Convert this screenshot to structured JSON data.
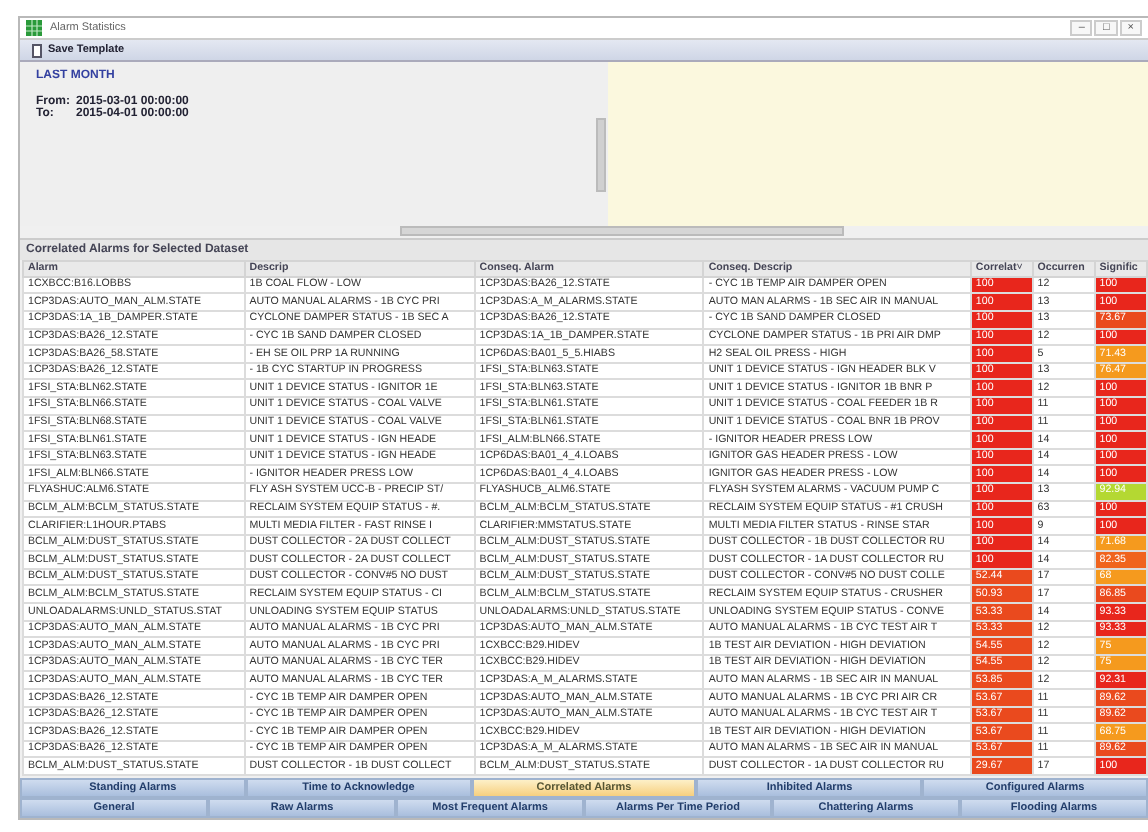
{
  "window": {
    "title": "Alarm Statistics",
    "controls": [
      "–",
      "□",
      "×"
    ]
  },
  "toolbar": {
    "save_button": "Save Template"
  },
  "period": {
    "name": "LAST MONTH",
    "from_label": "From:",
    "from": "2015-03-01 00:00:00",
    "to_label": "To:",
    "to": "2015-04-01 00:00:00"
  },
  "section_title": "Correlated Alarms for Selected Dataset",
  "table": {
    "columns": [
      {
        "label": "Alarm"
      },
      {
        "label": "Descrip"
      },
      {
        "label": "Conseq. Alarm"
      },
      {
        "label": "Conseq. Descrip"
      },
      {
        "label": "Correlat",
        "sort": "˅"
      },
      {
        "label": "Occurren"
      },
      {
        "label": "Signific"
      }
    ],
    "rows": [
      {
        "alarm": "1CXBCC:B16.LOBBS",
        "descrip": "1B COAL FLOW - LOW",
        "conseq_alarm": "1CP3DAS:BA26_12.STATE",
        "conseq_descrip": "- CYC 1B TEMP AIR DAMPER OPEN",
        "correlation": {
          "text": "100",
          "color": "#e8261c"
        },
        "occurrences": "12",
        "significance": {
          "text": "100",
          "color": "#e8261c"
        }
      },
      {
        "alarm": "1CP3DAS:AUTO_MAN_ALM.STATE",
        "descrip": "AUTO MANUAL ALARMS - 1B CYC PRI",
        "conseq_alarm": "1CP3DAS:A_M_ALARMS.STATE",
        "conseq_descrip": "AUTO MAN ALARMS - 1B SEC AIR IN MANUAL",
        "correlation": {
          "text": "100",
          "color": "#e8261c"
        },
        "occurrences": "13",
        "significance": {
          "text": "100",
          "color": "#e8261c"
        }
      },
      {
        "alarm": "1CP3DAS:1A_1B_DAMPER.STATE",
        "descrip": "CYCLONE DAMPER STATUS - 1B SEC A",
        "conseq_alarm": "1CP3DAS:BA26_12.STATE",
        "conseq_descrip": "- CYC 1B SAND DAMPER CLOSED",
        "correlation": {
          "text": "100",
          "color": "#e8261c"
        },
        "occurrences": "13",
        "significance": {
          "text": "73.67",
          "color": "#ea4a1e"
        }
      },
      {
        "alarm": "1CP3DAS:BA26_12.STATE",
        "descrip": "- CYC 1B SAND DAMPER CLOSED",
        "conseq_alarm": "1CP3DAS:1A_1B_DAMPER.STATE",
        "conseq_descrip": "CYCLONE DAMPER STATUS - 1B PRI AIR DMP",
        "correlation": {
          "text": "100",
          "color": "#e8261c"
        },
        "occurrences": "12",
        "significance": {
          "text": "100",
          "color": "#e8261c"
        }
      },
      {
        "alarm": "1CP3DAS:BA26_58.STATE",
        "descrip": "- EH SE OIL PRP 1A RUNNING",
        "conseq_alarm": "1CP6DAS:BA01_5_5.HIABS",
        "conseq_descrip": "H2 SEAL OIL PRESS - HIGH",
        "correlation": {
          "text": "100",
          "color": "#e8261c"
        },
        "occurrences": "5",
        "significance": {
          "text": "71.43",
          "color": "#f59a1e"
        }
      },
      {
        "alarm": "1CP3DAS:BA26_12.STATE",
        "descrip": "- 1B CYC STARTUP IN PROGRESS",
        "conseq_alarm": "1FSI_STA:BLN63.STATE",
        "conseq_descrip": "UNIT 1 DEVICE STATUS - IGN HEADER BLK V",
        "correlation": {
          "text": "100",
          "color": "#e8261c"
        },
        "occurrences": "13",
        "significance": {
          "text": "76.47",
          "color": "#f59a1e"
        }
      },
      {
        "alarm": "1FSI_STA:BLN62.STATE",
        "descrip": "UNIT 1 DEVICE STATUS - IGNITOR 1E",
        "conseq_alarm": "1FSI_STA:BLN63.STATE",
        "conseq_descrip": "UNIT 1 DEVICE STATUS - IGNITOR 1B BNR P",
        "correlation": {
          "text": "100",
          "color": "#e8261c"
        },
        "occurrences": "12",
        "significance": {
          "text": "100",
          "color": "#e8261c"
        }
      },
      {
        "alarm": "1FSI_STA:BLN66.STATE",
        "descrip": "UNIT 1 DEVICE STATUS - COAL VALVE",
        "conseq_alarm": "1FSI_STA:BLN61.STATE",
        "conseq_descrip": "UNIT 1 DEVICE STATUS - COAL FEEDER 1B R",
        "correlation": {
          "text": "100",
          "color": "#e8261c"
        },
        "occurrences": "11",
        "significance": {
          "text": "100",
          "color": "#e8261c"
        }
      },
      {
        "alarm": "1FSI_STA:BLN68.STATE",
        "descrip": "UNIT 1 DEVICE STATUS - COAL VALVE",
        "conseq_alarm": "1FSI_STA:BLN61.STATE",
        "conseq_descrip": "UNIT 1 DEVICE STATUS - COAL BNR 1B PROV",
        "correlation": {
          "text": "100",
          "color": "#e8261c"
        },
        "occurrences": "11",
        "significance": {
          "text": "100",
          "color": "#e8261c"
        }
      },
      {
        "alarm": "1FSI_STA:BLN61.STATE",
        "descrip": "UNIT 1 DEVICE STATUS - IGN HEADE",
        "conseq_alarm": "1FSI_ALM:BLN66.STATE",
        "conseq_descrip": "- IGNITOR HEADER PRESS LOW",
        "correlation": {
          "text": "100",
          "color": "#e8261c"
        },
        "occurrences": "14",
        "significance": {
          "text": "100",
          "color": "#e8261c"
        }
      },
      {
        "alarm": "1FSI_STA:BLN63.STATE",
        "descrip": "UNIT 1 DEVICE STATUS - IGN HEADE",
        "conseq_alarm": "1CP6DAS:BA01_4_4.LOABS",
        "conseq_descrip": "IGNITOR GAS HEADER PRESS - LOW",
        "correlation": {
          "text": "100",
          "color": "#e8261c"
        },
        "occurrences": "14",
        "significance": {
          "text": "100",
          "color": "#e8261c"
        }
      },
      {
        "alarm": "1FSI_ALM:BLN66.STATE",
        "descrip": "- IGNITOR HEADER PRESS LOW",
        "conseq_alarm": "1CP6DAS:BA01_4_4.LOABS",
        "conseq_descrip": "IGNITOR GAS HEADER PRESS - LOW",
        "correlation": {
          "text": "100",
          "color": "#e8261c"
        },
        "occurrences": "14",
        "significance": {
          "text": "100",
          "color": "#e8261c"
        }
      },
      {
        "alarm": "FLYASHUC:ALM6.STATE",
        "descrip": "FLY ASH SYSTEM UCC-B - PRECIP ST/",
        "conseq_alarm": "FLYASHUCB_ALM6.STATE",
        "conseq_descrip": "FLYASH SYSTEM ALARMS - VACUUM PUMP C",
        "correlation": {
          "text": "100",
          "color": "#e8261c"
        },
        "occurrences": "13",
        "significance": {
          "text": "92.94",
          "color": "#b4d832"
        }
      },
      {
        "alarm": "BCLM_ALM:BCLM_STATUS.STATE",
        "descrip": "RECLAIM SYSTEM EQUIP STATUS - #.",
        "conseq_alarm": "BCLM_ALM:BCLM_STATUS.STATE",
        "conseq_descrip": "RECLAIM SYSTEM EQUIP STATUS - #1 CRUSH",
        "correlation": {
          "text": "100",
          "color": "#e8261c"
        },
        "occurrences": "63",
        "significance": {
          "text": "100",
          "color": "#e8261c"
        }
      },
      {
        "alarm": "CLARIFIER:L1HOUR.PTABS",
        "descrip": "MULTI MEDIA FILTER - FAST RINSE I",
        "conseq_alarm": "CLARIFIER:MMSTATUS.STATE",
        "conseq_descrip": "MULTI MEDIA FILTER STATUS - RINSE STAR",
        "correlation": {
          "text": "100",
          "color": "#e8261c"
        },
        "occurrences": "9",
        "significance": {
          "text": "100",
          "color": "#e8261c"
        }
      },
      {
        "alarm": "BCLM_ALM:DUST_STATUS.STATE",
        "descrip": "DUST COLLECTOR - 2A DUST COLLECT",
        "conseq_alarm": "BCLM_ALM:DUST_STATUS.STATE",
        "conseq_descrip": "DUST COLLECTOR - 1B DUST COLLECTOR RU",
        "correlation": {
          "text": "100",
          "color": "#e8261c"
        },
        "occurrences": "14",
        "significance": {
          "text": "71.68",
          "color": "#f59a1e"
        }
      },
      {
        "alarm": "BCLM_ALM:DUST_STATUS.STATE",
        "descrip": "DUST COLLECTOR - 2A DUST COLLECT",
        "conseq_alarm": "BCLM_ALM:DUST_STATUS.STATE",
        "conseq_descrip": "DUST COLLECTOR - 1A DUST COLLECTOR RU",
        "correlation": {
          "text": "100",
          "color": "#e8261c"
        },
        "occurrences": "14",
        "significance": {
          "text": "82.35",
          "color": "#f0641e"
        }
      },
      {
        "alarm": "BCLM_ALM:DUST_STATUS.STATE",
        "descrip": "DUST COLLECTOR - CONV#5 NO DUST",
        "conseq_alarm": "BCLM_ALM:DUST_STATUS.STATE",
        "conseq_descrip": "DUST COLLECTOR - CONV#5 NO DUST COLLE",
        "correlation": {
          "text": "52.44",
          "color": "#ea4a1e"
        },
        "occurrences": "17",
        "significance": {
          "text": "68",
          "color": "#f59a1e"
        }
      },
      {
        "alarm": "BCLM_ALM:BCLM_STATUS.STATE",
        "descrip": "RECLAIM SYSTEM EQUIP STATUS - CI",
        "conseq_alarm": "BCLM_ALM:BCLM_STATUS.STATE",
        "conseq_descrip": "RECLAIM SYSTEM EQUIP STATUS - CRUSHER",
        "correlation": {
          "text": "50.93",
          "color": "#ea4a1e"
        },
        "occurrences": "17",
        "significance": {
          "text": "86.85",
          "color": "#ea4a1e"
        }
      },
      {
        "alarm": "UNLOADALARMS:UNLD_STATUS.STAT",
        "descrip": "UNLOADING SYSTEM EQUIP STATUS",
        "conseq_alarm": "UNLOADALARMS:UNLD_STATUS.STATE",
        "conseq_descrip": "UNLOADING SYSTEM EQUIP STATUS - CONVE",
        "correlation": {
          "text": "53.33",
          "color": "#ea4a1e"
        },
        "occurrences": "14",
        "significance": {
          "text": "93.33",
          "color": "#e8261c"
        }
      },
      {
        "alarm": "1CP3DAS:AUTO_MAN_ALM.STATE",
        "descrip": "AUTO MANUAL ALARMS - 1B CYC PRI",
        "conseq_alarm": "1CP3DAS:AUTO_MAN_ALM.STATE",
        "conseq_descrip": "AUTO MANUAL ALARMS - 1B CYC TEST AIR T",
        "correlation": {
          "text": "53.33",
          "color": "#ea4a1e"
        },
        "occurrences": "12",
        "significance": {
          "text": "93.33",
          "color": "#e8261c"
        }
      },
      {
        "alarm": "1CP3DAS:AUTO_MAN_ALM.STATE",
        "descrip": "AUTO MANUAL ALARMS - 1B CYC PRI",
        "conseq_alarm": "1CXBCC:B29.HIDEV",
        "conseq_descrip": "1B TEST AIR DEVIATION - HIGH DEVIATION",
        "correlation": {
          "text": "54.55",
          "color": "#ea4a1e"
        },
        "occurrences": "12",
        "significance": {
          "text": "75",
          "color": "#f59a1e"
        }
      },
      {
        "alarm": "1CP3DAS:AUTO_MAN_ALM.STATE",
        "descrip": "AUTO MANUAL ALARMS - 1B CYC TER",
        "conseq_alarm": "1CXBCC:B29.HIDEV",
        "conseq_descrip": "1B TEST AIR DEVIATION - HIGH DEVIATION",
        "correlation": {
          "text": "54.55",
          "color": "#ea4a1e"
        },
        "occurrences": "12",
        "significance": {
          "text": "75",
          "color": "#f59a1e"
        }
      },
      {
        "alarm": "1CP3DAS:AUTO_MAN_ALM.STATE",
        "descrip": "AUTO MANUAL ALARMS - 1B CYC TER",
        "conseq_alarm": "1CP3DAS:A_M_ALARMS.STATE",
        "conseq_descrip": "AUTO MAN ALARMS - 1B SEC AIR IN MANUAL",
        "correlation": {
          "text": "53.85",
          "color": "#ea4a1e"
        },
        "occurrences": "12",
        "significance": {
          "text": "92.31",
          "color": "#e8261c"
        }
      },
      {
        "alarm": "1CP3DAS:BA26_12.STATE",
        "descrip": "- CYC 1B TEMP AIR DAMPER OPEN",
        "conseq_alarm": "1CP3DAS:AUTO_MAN_ALM.STATE",
        "conseq_descrip": "AUTO MANUAL ALARMS - 1B CYC PRI AIR CR",
        "correlation": {
          "text": "53.67",
          "color": "#ea4a1e"
        },
        "occurrences": "11",
        "significance": {
          "text": "89.62",
          "color": "#ea4a1e"
        }
      },
      {
        "alarm": "1CP3DAS:BA26_12.STATE",
        "descrip": "- CYC 1B TEMP AIR DAMPER OPEN",
        "conseq_alarm": "1CP3DAS:AUTO_MAN_ALM.STATE",
        "conseq_descrip": "AUTO MANUAL ALARMS - 1B CYC TEST AIR T",
        "correlation": {
          "text": "53.67",
          "color": "#ea4a1e"
        },
        "occurrences": "11",
        "significance": {
          "text": "89.62",
          "color": "#ea4a1e"
        }
      },
      {
        "alarm": "1CP3DAS:BA26_12.STATE",
        "descrip": "- CYC 1B TEMP AIR DAMPER OPEN",
        "conseq_alarm": "1CXBCC:B29.HIDEV",
        "conseq_descrip": "1B TEST AIR DEVIATION - HIGH DEVIATION",
        "correlation": {
          "text": "53.67",
          "color": "#ea4a1e"
        },
        "occurrences": "11",
        "significance": {
          "text": "68.75",
          "color": "#f59a1e"
        }
      },
      {
        "alarm": "1CP3DAS:BA26_12.STATE",
        "descrip": "- CYC 1B TEMP AIR DAMPER OPEN",
        "conseq_alarm": "1CP3DAS:A_M_ALARMS.STATE",
        "conseq_descrip": "AUTO MAN ALARMS - 1B SEC AIR IN MANUAL",
        "correlation": {
          "text": "53.67",
          "color": "#ea4a1e"
        },
        "occurrences": "11",
        "significance": {
          "text": "89.62",
          "color": "#ea4a1e"
        }
      },
      {
        "alarm": "BCLM_ALM:DUST_STATUS.STATE",
        "descrip": "DUST COLLECTOR - 1B DUST COLLECT",
        "conseq_alarm": "BCLM_ALM:DUST_STATUS.STATE",
        "conseq_descrip": "DUST COLLECTOR - 1A DUST COLLECTOR RU",
        "correlation": {
          "text": "29.67",
          "color": "#ea4a1e"
        },
        "occurrences": "17",
        "significance": {
          "text": "100",
          "color": "#e8261c"
        }
      }
    ]
  },
  "tabs_top": [
    {
      "label": "Standing Alarms",
      "selected": false
    },
    {
      "label": "Time to Acknowledge",
      "selected": false
    },
    {
      "label": "Correlated Alarms",
      "selected": true
    },
    {
      "label": "Inhibited Alarms",
      "selected": false
    },
    {
      "label": "Configured Alarms",
      "selected": false
    }
  ],
  "tabs_bottom": [
    {
      "label": "General",
      "selected": false
    },
    {
      "label": "Raw Alarms",
      "selected": false
    },
    {
      "label": "Most Frequent Alarms",
      "selected": false
    },
    {
      "label": "Alarms Per Time Period",
      "selected": false
    },
    {
      "label": "Chattering Alarms",
      "selected": false
    },
    {
      "label": "Flooding Alarms",
      "selected": false
    }
  ]
}
